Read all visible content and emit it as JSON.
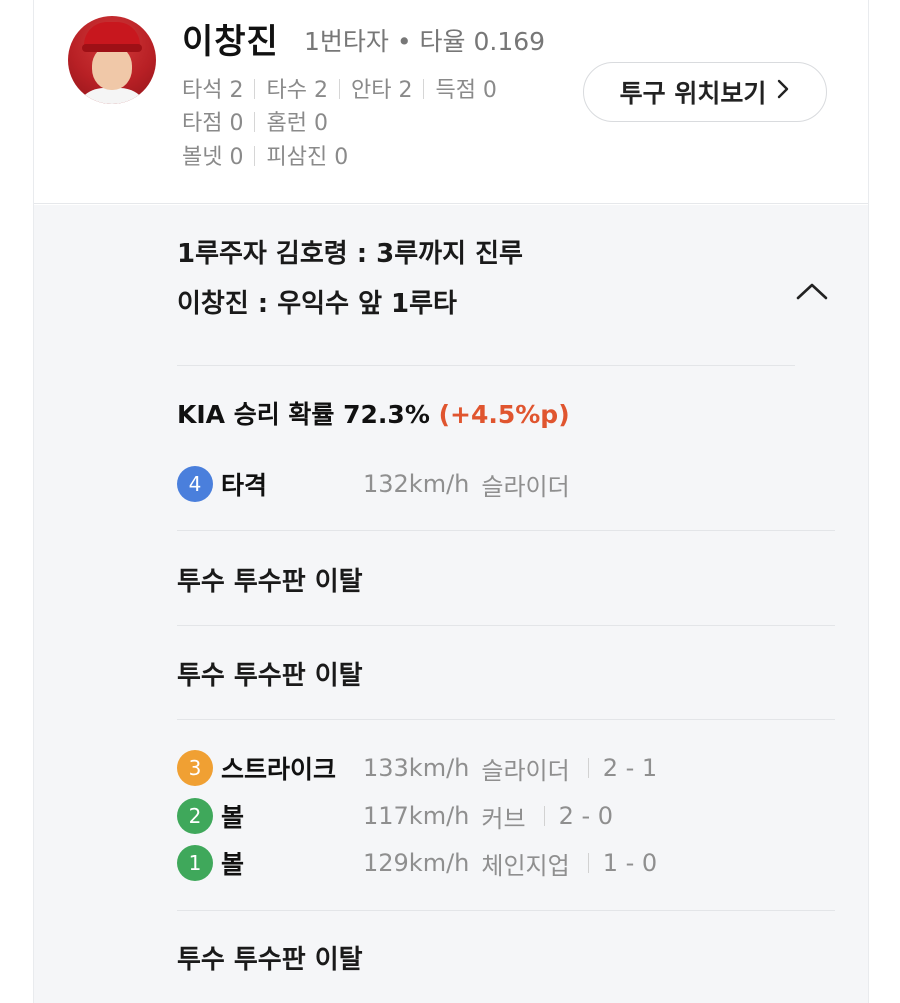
{
  "player": {
    "name": "이창진",
    "subtitle": "1번타자 • 타율 0.169",
    "stats_row1": [
      "타석 2",
      "타수 2",
      "안타 2",
      "득점 0"
    ],
    "stats_row2": [
      "타점 0",
      "홈런 0"
    ],
    "stats_row3": [
      "볼넷 0",
      "피삼진 0"
    ]
  },
  "pitch_location_button": {
    "label": "투구 위치보기",
    "icon": "chevron-right-icon"
  },
  "play": {
    "line1": "1루주자 김호령 : 3루까지 진루",
    "line2": "이창진 : 우익수 앞 1루타",
    "collapse_icon": "chevron-up-icon"
  },
  "win_probability": {
    "text": "KIA 승리 확률 72.3%",
    "delta": "(+4.5%p)",
    "delta_color": "#e0552f"
  },
  "hit_pitch": {
    "number": "4",
    "result": "타격",
    "speed": "132km/h",
    "type": "슬라이더",
    "badge_color": "#4a7fdc"
  },
  "pickoffs": [
    "투수 투수판 이탈",
    "투수 투수판 이탈",
    "투수 투수판 이탈"
  ],
  "pitches": [
    {
      "number": "3",
      "result": "스트라이크",
      "speed": "133km/h",
      "type": "슬라이더",
      "count": "2 - 1",
      "badge_color": "#f0a033"
    },
    {
      "number": "2",
      "result": "볼",
      "speed": "117km/h",
      "type": "커브",
      "count": "2 - 0",
      "badge_color": "#3fa85b"
    },
    {
      "number": "1",
      "result": "볼",
      "speed": "129km/h",
      "type": "체인지업",
      "count": "1 - 0",
      "badge_color": "#3fa85b"
    }
  ]
}
